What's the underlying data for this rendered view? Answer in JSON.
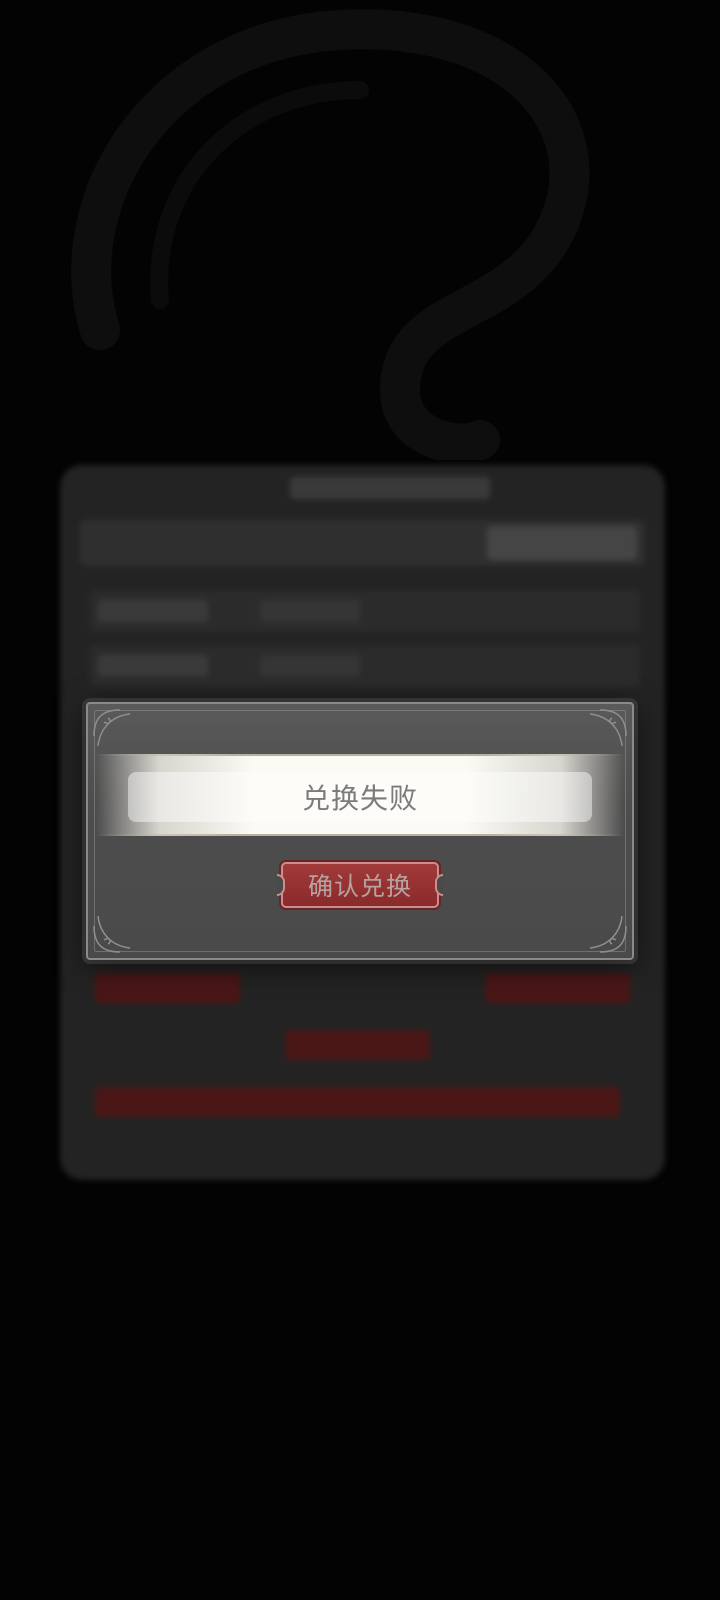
{
  "dialog": {
    "message": "兑换失败",
    "confirm_label": "确认兑换"
  },
  "icons": {
    "corner_ornament": "ornament-corner-icon"
  },
  "colors": {
    "background": "#030303",
    "dialog_bg": "#4d4d4d",
    "button_red": "#8a2a2a",
    "message_text": "#7b7b7b"
  }
}
